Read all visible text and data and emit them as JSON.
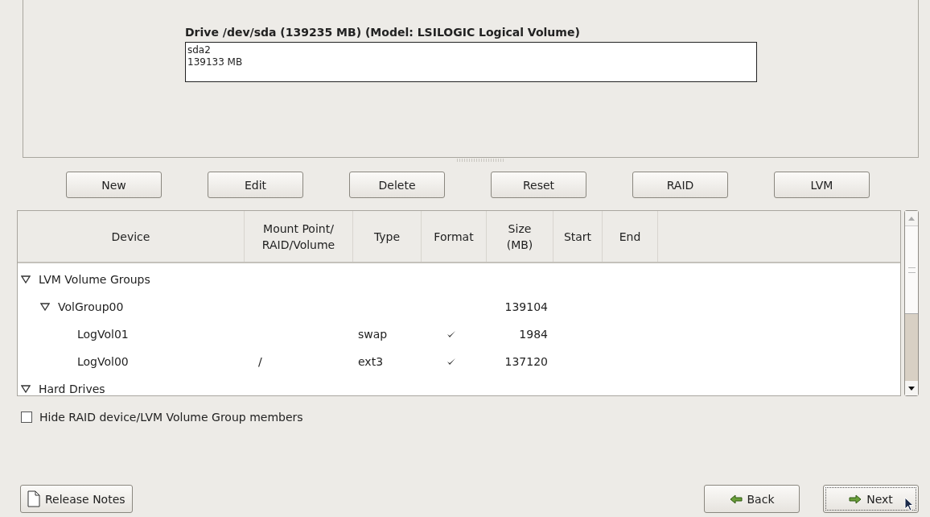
{
  "drive": {
    "title": "Drive /dev/sda (139235 MB) (Model: LSILOGIC Logical Volume)",
    "partitions": [
      {
        "name": "sda2",
        "size": "139133 MB"
      }
    ]
  },
  "buttons": [
    "New",
    "Edit",
    "Delete",
    "Reset",
    "RAID",
    "LVM"
  ],
  "table": {
    "columns": [
      "Device",
      "Mount Point/\nRAID/Volume",
      "Type",
      "Format",
      "Size\n(MB)",
      "Start",
      "End"
    ],
    "rows": [
      {
        "device": "LVM Volume Groups",
        "expanded": true,
        "children": [
          {
            "device": "VolGroup00",
            "size": "139104",
            "expanded": true,
            "children": [
              {
                "device": "LogVol01",
                "type": "swap",
                "format": true,
                "size": "1984"
              },
              {
                "device": "LogVol00",
                "mount": "/",
                "type": "ext3",
                "format": true,
                "size": "137120"
              }
            ]
          }
        ]
      },
      {
        "device": "Hard Drives",
        "expanded": true
      }
    ]
  },
  "hide_members": {
    "label": "Hide RAID device/LVM Volume Group members",
    "checked": false
  },
  "footer": {
    "release_notes": "Release Notes",
    "back": "Back",
    "next": "Next"
  }
}
